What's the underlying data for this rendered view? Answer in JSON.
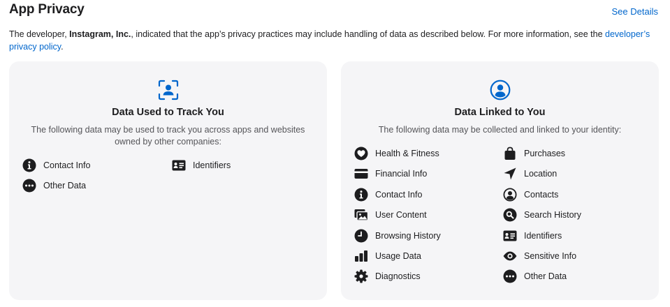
{
  "header": {
    "title": "App Privacy",
    "see_details": "See Details"
  },
  "description": {
    "prefix": "The developer, ",
    "developer": "Instagram, Inc.",
    "middle": ", indicated that the app’s privacy practices may include handling of data as described below. For more information, see the ",
    "link": "developer’s privacy policy",
    "suffix": "."
  },
  "track_card": {
    "icon": "track-person-icon",
    "title": "Data Used to Track You",
    "subtitle": "The following data may be used to track you across apps and websites owned by other companies:",
    "items": [
      {
        "label": "Contact Info",
        "icon": "info-icon"
      },
      {
        "label": "Identifiers",
        "icon": "id-card-icon"
      },
      {
        "label": "Other Data",
        "icon": "ellipsis-icon"
      }
    ]
  },
  "linked_card": {
    "icon": "person-circle-icon",
    "title": "Data Linked to You",
    "subtitle": "The following data may be collected and linked to your identity:",
    "items": [
      {
        "label": "Health & Fitness",
        "icon": "heart-icon"
      },
      {
        "label": "Purchases",
        "icon": "bag-icon"
      },
      {
        "label": "Financial Info",
        "icon": "credit-card-icon"
      },
      {
        "label": "Location",
        "icon": "location-arrow-icon"
      },
      {
        "label": "Contact Info",
        "icon": "info-icon"
      },
      {
        "label": "Contacts",
        "icon": "contacts-icon"
      },
      {
        "label": "User Content",
        "icon": "photos-icon"
      },
      {
        "label": "Search History",
        "icon": "magnifier-icon"
      },
      {
        "label": "Browsing History",
        "icon": "clock-icon"
      },
      {
        "label": "Identifiers",
        "icon": "id-card-icon"
      },
      {
        "label": "Usage Data",
        "icon": "bar-chart-icon"
      },
      {
        "label": "Sensitive Info",
        "icon": "eye-icon"
      },
      {
        "label": "Diagnostics",
        "icon": "gear-icon"
      },
      {
        "label": "Other Data",
        "icon": "ellipsis-icon"
      }
    ]
  },
  "colors": {
    "accent": "#0066cc",
    "card_background": "#f5f5f7",
    "icon": "#1d1d1f"
  }
}
